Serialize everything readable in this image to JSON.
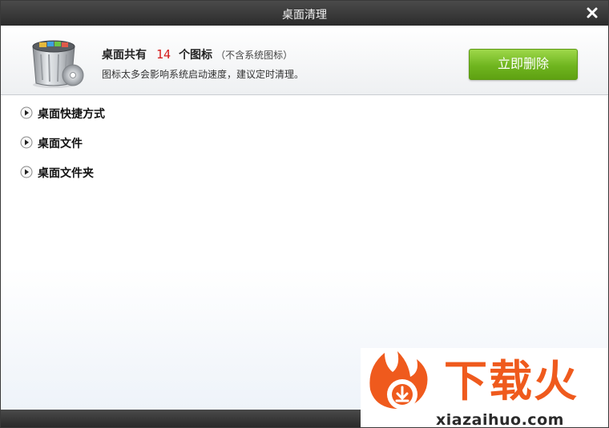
{
  "window": {
    "title": "桌面清理"
  },
  "header": {
    "summary_prefix": "桌面共有",
    "icon_count": "14",
    "summary_suffix": "个图标",
    "summary_note": "（不含系统图标）",
    "hint": "图标太多会影响系统启动速度，建议定时清理。",
    "delete_label": "立即删除"
  },
  "categories": [
    {
      "label": "桌面快捷方式"
    },
    {
      "label": "桌面文件"
    },
    {
      "label": "桌面文件夹"
    }
  ],
  "watermark": {
    "logo_text": "下载火",
    "domain": "xiazaihuo.com"
  },
  "colors": {
    "titlebar": "#333333",
    "count": "#d41a1a",
    "button_green": "#6fb51f",
    "watermark_orange": "#ef5a1d"
  },
  "icons": {
    "close": "close-icon",
    "trash": "trash-can-icon",
    "expand": "play-arrow-icon"
  }
}
